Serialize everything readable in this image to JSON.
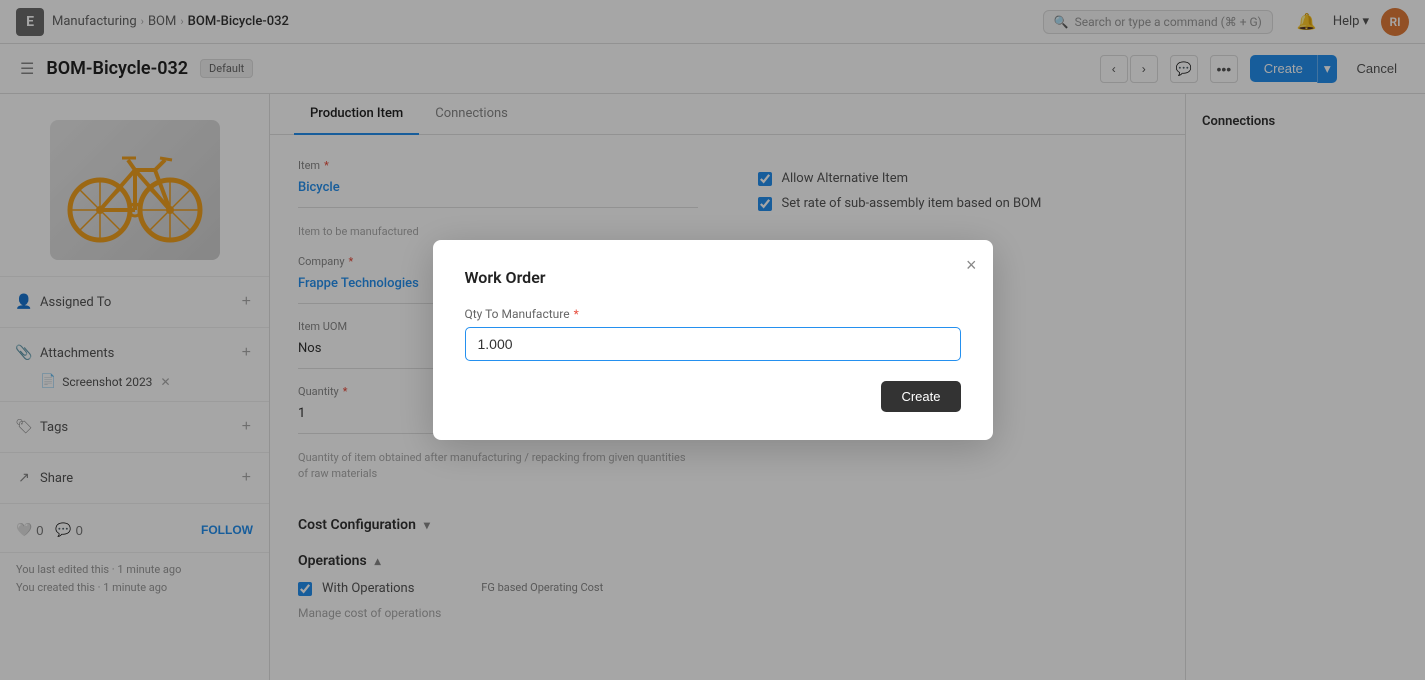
{
  "nav": {
    "logo": "E",
    "breadcrumbs": [
      {
        "label": "Manufacturing",
        "href": "#"
      },
      {
        "label": "BOM",
        "href": "#"
      },
      {
        "label": "BOM-Bicycle-032",
        "href": "#",
        "current": true
      }
    ],
    "search_placeholder": "Search or type a command (⌘ + G)",
    "help_label": "Help",
    "avatar_initials": "RI"
  },
  "page_header": {
    "title": "BOM-Bicycle-032",
    "badge": "Default",
    "create_label": "Create",
    "cancel_label": "Cancel"
  },
  "tabs": [
    {
      "label": "Production Item",
      "active": true
    },
    {
      "label": "Connections",
      "active": false
    }
  ],
  "form": {
    "item_label": "Item",
    "item_required": true,
    "item_value": "Bicycle",
    "item_hint": "Item to be manufactured",
    "company_label": "Company",
    "company_required": true,
    "company_value": "Frappe Technologies",
    "item_uom_label": "Item UOM",
    "item_uom_value": "Nos",
    "quantity_label": "Quantity",
    "quantity_required": true,
    "quantity_value": "1",
    "quantity_hint": "Quantity of item obtained after manufacturing / repacking from given quantities of raw materials",
    "allow_alternative_item_label": "Allow Alternative Item",
    "allow_alternative_item_checked": true,
    "set_rate_label": "Set rate of sub-assembly item based on BOM",
    "set_rate_checked": true
  },
  "cost_configuration": {
    "section_label": "Cost Configuration",
    "collapsed": true,
    "toggle_icon": "▾"
  },
  "operations": {
    "section_label": "Operations",
    "expanded": true,
    "toggle_icon": "▴",
    "with_operations_label": "With Operations",
    "with_operations_checked": true,
    "fg_based_label": "FG based Operating Cost",
    "manage_cost_label": "Manage cost of operations"
  },
  "sidebar": {
    "assigned_to_label": "Assigned To",
    "attachments_label": "Attachments",
    "attachment_file": "Screenshot 2023",
    "tags_label": "Tags",
    "share_label": "Share",
    "likes_count": "0",
    "comments_count": "0",
    "follow_label": "FOLLOW",
    "last_edited_text": "You last edited this · 1 minute ago",
    "created_text": "You created this · 1 minute ago"
  },
  "modal": {
    "title": "Work Order",
    "qty_label": "Qty To Manufacture",
    "qty_required": true,
    "qty_value": "1.000",
    "create_label": "Create",
    "close_icon": "×"
  }
}
